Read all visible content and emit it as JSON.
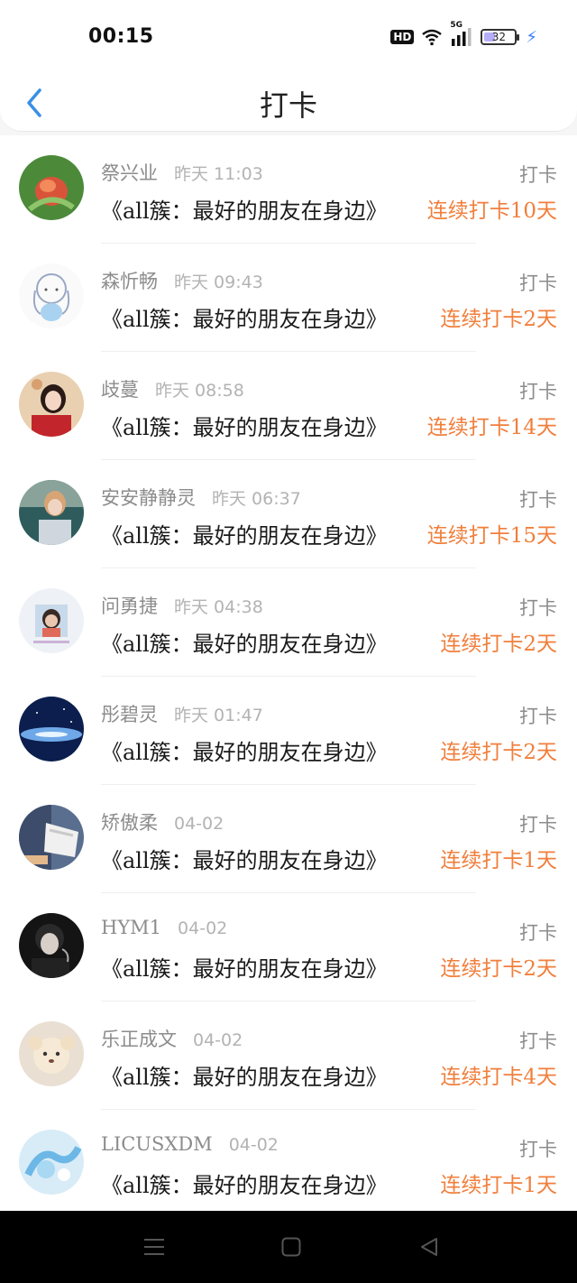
{
  "status_bar": {
    "time": "00:15",
    "hd": "HD",
    "network": "5G",
    "battery": "32"
  },
  "header": {
    "title": "打卡",
    "back_icon": "chevron-left-icon"
  },
  "colors": {
    "accent": "#3a8ee6",
    "streak": "#f07f3c"
  },
  "items": [
    {
      "name": "祭兴业",
      "time": "昨天 11:03",
      "action": "打卡",
      "content": "《all簇：最好的朋友在身边》",
      "streak": "连续打卡10天"
    },
    {
      "name": "森忻畅",
      "time": "昨天 09:43",
      "action": "打卡",
      "content": "《all簇：最好的朋友在身边》",
      "streak": "连续打卡2天"
    },
    {
      "name": "歧蔓",
      "time": "昨天 08:58",
      "action": "打卡",
      "content": "《all簇：最好的朋友在身边》",
      "streak": "连续打卡14天"
    },
    {
      "name": "安安静静灵",
      "time": "昨天 06:37",
      "action": "打卡",
      "content": "《all簇：最好的朋友在身边》",
      "streak": "连续打卡15天"
    },
    {
      "name": "问勇捷",
      "time": "昨天 04:38",
      "action": "打卡",
      "content": "《all簇：最好的朋友在身边》",
      "streak": "连续打卡2天"
    },
    {
      "name": "彤碧灵",
      "time": "昨天 01:47",
      "action": "打卡",
      "content": "《all簇：最好的朋友在身边》",
      "streak": "连续打卡2天"
    },
    {
      "name": "矫傲柔",
      "time": "04-02",
      "action": "打卡",
      "content": "《all簇：最好的朋友在身边》",
      "streak": "连续打卡1天"
    },
    {
      "name": "HYM1",
      "time": "04-02",
      "action": "打卡",
      "content": "《all簇：最好的朋友在身边》",
      "streak": "连续打卡2天"
    },
    {
      "name": "乐正成文",
      "time": "04-02",
      "action": "打卡",
      "content": "《all簇：最好的朋友在身边》",
      "streak": "连续打卡4天"
    },
    {
      "name": "LICUSXDM",
      "time": "04-02",
      "action": "打卡",
      "content": "《all簇：最好的朋友在身边》",
      "streak": "连续打卡1天"
    }
  ]
}
